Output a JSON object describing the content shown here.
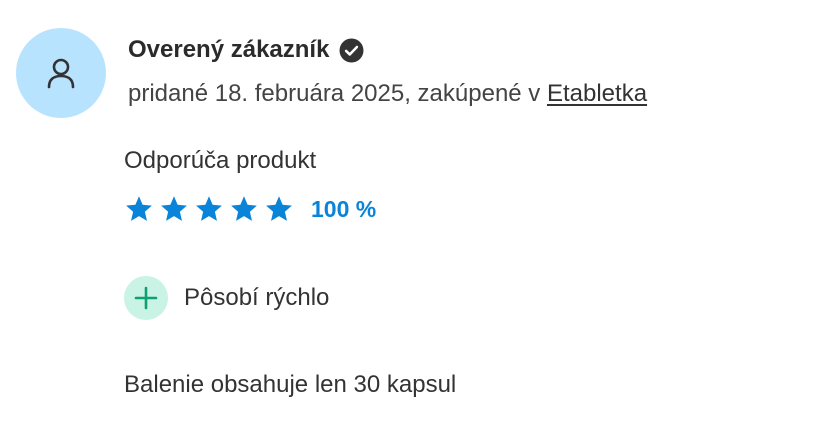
{
  "review": {
    "author": "Overený zákazník",
    "verified_icon": "check-circle-icon",
    "avatar_icon": "user-icon",
    "meta_prefix": "pridané 18. februára 2025, zakúpené v ",
    "shop_name": "Etabletka",
    "recommend_label": "Odporúča produkt",
    "rating": {
      "stars_filled": 5,
      "stars_total": 5,
      "percent_text": "100 %"
    },
    "pros": [
      {
        "icon": "plus-icon",
        "text": "Pôsobí rýchlo"
      }
    ],
    "text": "Balenie obsahuje len 30 kapsul"
  },
  "colors": {
    "avatar_bg": "#b8e3ff",
    "star": "#0a84d9",
    "percent": "#0a84d9",
    "plus_bg": "#c9f3e4",
    "plus": "#0f9f73"
  }
}
